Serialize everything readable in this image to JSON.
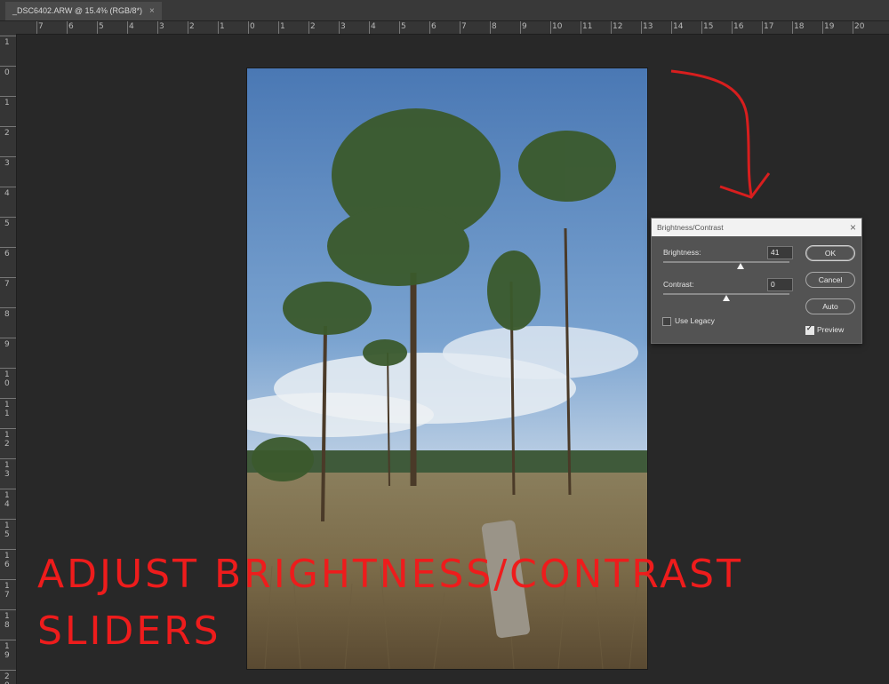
{
  "document": {
    "tab_title": "_DSC6402.ARW @ 15.4% (RGB/8*)",
    "close_glyph": "×"
  },
  "rulers": {
    "horizontal_labels": [
      "7",
      "6",
      "5",
      "4",
      "3",
      "2",
      "1",
      "0",
      "1",
      "2",
      "3",
      "4",
      "5",
      "6",
      "7",
      "8",
      "9",
      "10",
      "11",
      "12",
      "13",
      "14",
      "15",
      "16",
      "17",
      "18",
      "19",
      "20"
    ],
    "vertical_labels": [
      "1",
      "0",
      "1",
      "2",
      "3",
      "4",
      "5",
      "6",
      "7",
      "8",
      "9",
      "1 0",
      "1 1",
      "1 2",
      "1 3",
      "1 4",
      "1 5",
      "1 6",
      "1 7",
      "1 8",
      "1 9",
      "2 0"
    ]
  },
  "dialog": {
    "title": "Brightness/Contrast",
    "close_glyph": "×",
    "brightness": {
      "label": "Brightness:",
      "value": "41",
      "slider_fraction": 0.61
    },
    "contrast": {
      "label": "Contrast:",
      "value": "0",
      "slider_fraction": 0.5
    },
    "use_legacy": {
      "label": "Use Legacy",
      "checked": false
    },
    "preview": {
      "label": "Preview",
      "checked": true
    },
    "buttons": {
      "ok": "OK",
      "cancel": "Cancel",
      "auto": "Auto"
    }
  },
  "annotation": {
    "line1": "ADJUST BRIGHTNESS/CONTRAST",
    "line2": "SLIDERS",
    "color": "#ee1c1c"
  },
  "colors": {
    "workspace": "#282828",
    "dialog_bg": "#535353",
    "sky_top": "#4a7bb8",
    "grass": "#8a7a55"
  }
}
